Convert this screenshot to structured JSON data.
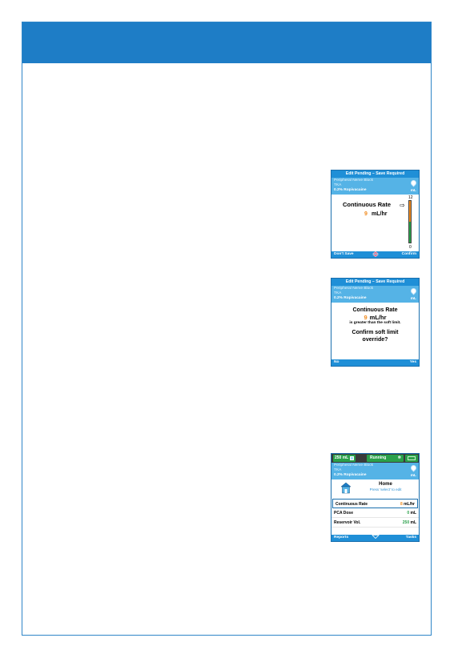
{
  "screens": {
    "soft_limit_rate": {
      "title": "Edit Pending – Save Required",
      "info": {
        "line1": "Peripheral Nerve Block",
        "line2": "TKA",
        "drug": "0.2% Ropivacaine",
        "unit": "mL"
      },
      "rate_label": "Continuous Rate",
      "rate_value": "9",
      "rate_unit": "mL/hr",
      "scale_max": "12",
      "scale_min": "0",
      "softkey_left": "Don't Save",
      "softkey_right": "Confirm"
    },
    "confirm_override": {
      "title": "Edit Pending – Save Required",
      "info": {
        "line1": "Peripheral Nerve Block",
        "line2": "TKA",
        "drug": "0.2% Ropivacaine",
        "unit": "mL"
      },
      "line1": "Continuous Rate",
      "value": "9",
      "unit": "mL/hr",
      "warning": "is greater than the soft limit.",
      "question_line1": "Confirm soft limit",
      "question_line2": "override?",
      "softkey_left": "No",
      "softkey_right": "Yes"
    },
    "home": {
      "status_volume": "250 mL",
      "status_running": "Running",
      "info": {
        "line1": "Peripheral Nerve Block",
        "line2": "TKA",
        "drug": "0.2% Ropivacaine",
        "unit": "mL"
      },
      "home_title": "Home",
      "home_hint": "Press 'select' to edit",
      "rows": [
        {
          "label": "Continuous Rate",
          "value": "8",
          "unit": "mL/hr"
        },
        {
          "label": "PCA Dose",
          "value": "0",
          "unit": "mL"
        },
        {
          "label": "Reservoir Vol.",
          "value": "250",
          "unit": "mL"
        }
      ],
      "softkey_left": "Reports",
      "softkey_right": "Tasks"
    }
  },
  "colors": {
    "accent": "#1e7dc6",
    "orange": "#f08a1d",
    "green": "#2aa04a"
  }
}
